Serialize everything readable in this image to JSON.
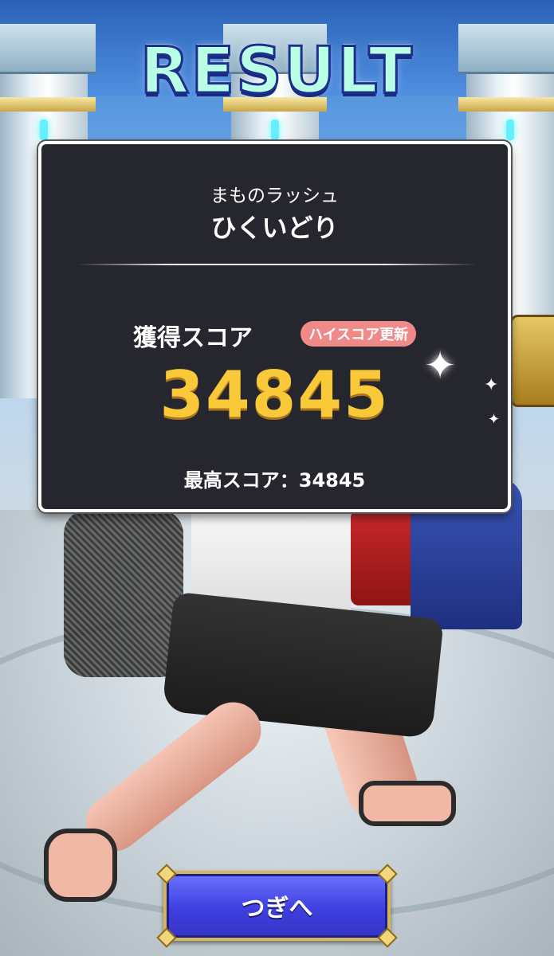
{
  "header": {
    "title": "RESULT"
  },
  "result": {
    "mode": "まものラッシュ",
    "stage": "ひくいどり",
    "score_label": "獲得スコア",
    "high_score_badge": "ハイスコア更新",
    "score": "34845",
    "best_score_text": "最高スコア：34845"
  },
  "footer": {
    "next_label": "つぎへ"
  },
  "colors": {
    "score": "#f9c93a",
    "badge": "#f08a88",
    "button": "#3f3fe0",
    "panel": "#26262e"
  }
}
